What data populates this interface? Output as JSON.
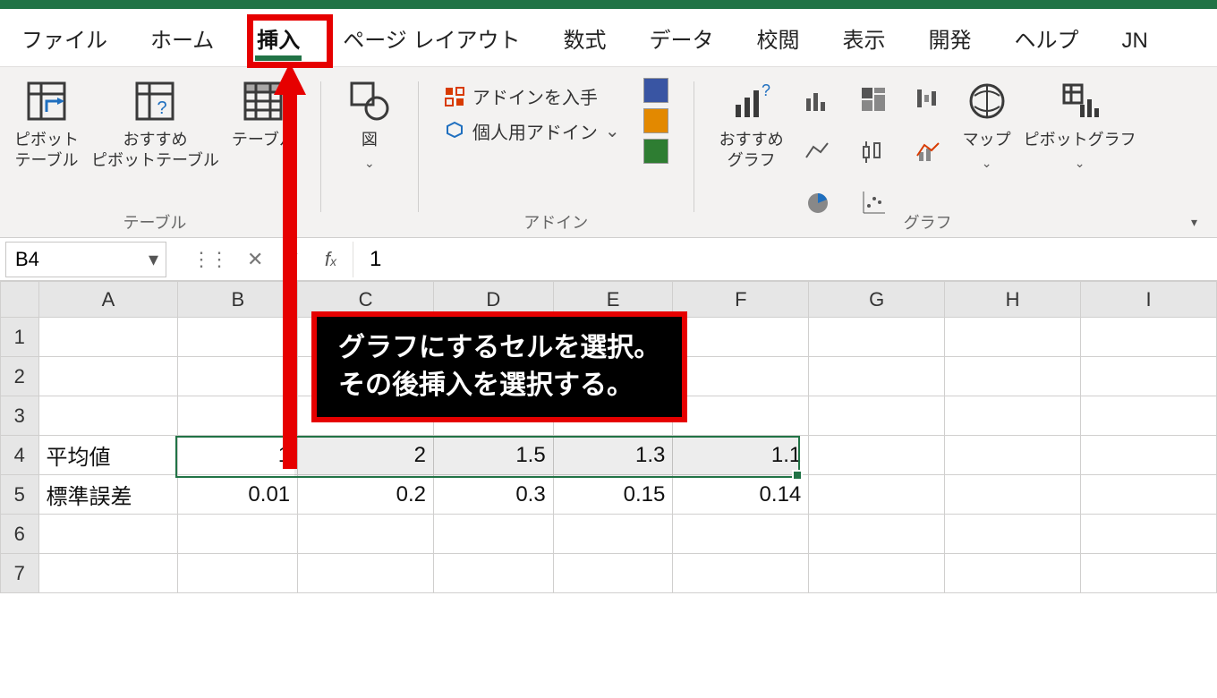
{
  "tabs": {
    "file": "ファイル",
    "home": "ホーム",
    "insert": "挿入",
    "pagelayout": "ページ レイアウト",
    "formulas": "数式",
    "data": "データ",
    "review": "校閲",
    "view": "表示",
    "developer": "開発",
    "help": "ヘルプ",
    "jn": "JN"
  },
  "ribbon": {
    "tables": {
      "pivot": "ピボット\nテーブル",
      "recommended_pivot": "おすすめ\nピボットテーブル",
      "table": "テーブル",
      "group_label": "テーブル"
    },
    "illustrations": {
      "pictures": "図",
      "dropdown": "⌄"
    },
    "addins": {
      "get": "アドインを入手",
      "personal": "個人用アドイン",
      "group_label": "アドイン"
    },
    "charts": {
      "recommended": "おすすめ\nグラフ",
      "map": "マップ",
      "pivotchart": "ピボットグラフ",
      "group_label": "グラフ"
    }
  },
  "formula_bar": {
    "namebox": "B4",
    "value": "1"
  },
  "columns": [
    "A",
    "B",
    "C",
    "D",
    "E",
    "F",
    "G",
    "H",
    "I"
  ],
  "rows": [
    "1",
    "2",
    "3",
    "4",
    "5",
    "6",
    "7"
  ],
  "cells": {
    "A4": "平均値",
    "B4": "1",
    "C4": "2",
    "D4": "1.5",
    "E4": "1.3",
    "F4": "1.1",
    "A5": "標準誤差",
    "B5": "0.01",
    "C5": "0.2",
    "D5": "0.3",
    "E5": "0.15",
    "F5": "0.14"
  },
  "callout": {
    "line1": "グラフにするセルを選択。",
    "line2": "その後挿入を選択する。"
  },
  "chart_data": {
    "type": "table",
    "title": "",
    "series": [
      {
        "name": "平均値",
        "values": [
          1,
          2,
          1.5,
          1.3,
          1.1
        ]
      },
      {
        "name": "標準誤差",
        "values": [
          0.01,
          0.2,
          0.3,
          0.15,
          0.14
        ]
      }
    ]
  }
}
